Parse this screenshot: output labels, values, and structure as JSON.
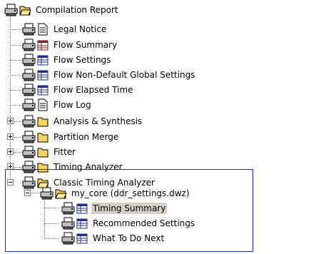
{
  "tree": {
    "root": {
      "label": "Compilation Report",
      "icon": "folder-open-icon"
    },
    "items": [
      {
        "label": "Legal Notice",
        "icon": "document-icon"
      },
      {
        "label": "Flow Summary",
        "icon": "summary-table-icon"
      },
      {
        "label": "Flow Settings",
        "icon": "table-icon"
      },
      {
        "label": "Flow Non-Default Global Settings",
        "icon": "table-icon"
      },
      {
        "label": "Flow Elapsed Time",
        "icon": "table-icon"
      },
      {
        "label": "Flow Log",
        "icon": "document-icon"
      },
      {
        "label": "Analysis & Synthesis",
        "icon": "folder-icon",
        "expander": "+"
      },
      {
        "label": "Partition Merge",
        "icon": "folder-icon",
        "expander": "+"
      },
      {
        "label": "Fitter",
        "icon": "folder-icon",
        "expander": "+"
      },
      {
        "label": "Timing Analyzer",
        "icon": "folder-icon",
        "expander": "+"
      },
      {
        "label": "Classic Timing Analyzer",
        "icon": "folder-open-icon",
        "expander": "-"
      },
      {
        "label": "my_core (ddr_settings.dwz)",
        "icon": "folder-open-icon",
        "expander": "-"
      },
      {
        "label": "Timing Summary",
        "icon": "table-icon",
        "selected": true
      },
      {
        "label": "Recommended Settings",
        "icon": "table-icon"
      },
      {
        "label": "What To Do Next",
        "icon": "table-icon"
      }
    ]
  },
  "colors": {
    "folder": "#f5d35a",
    "table_header": "#1f2f8f",
    "highlight_border": "#1a2fb8",
    "selection": "#d4d0c8"
  }
}
